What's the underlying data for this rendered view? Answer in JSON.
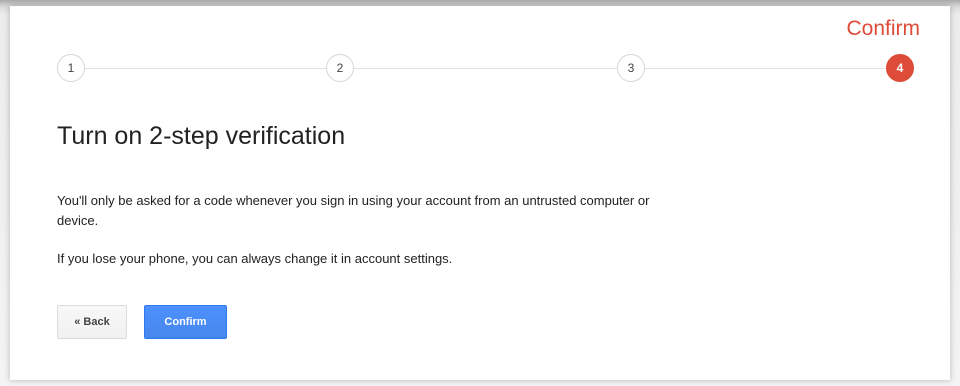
{
  "header": {
    "step_label": "Confirm"
  },
  "stepper": {
    "steps": [
      "1",
      "2",
      "3",
      "4"
    ],
    "active_step": 4,
    "colors": {
      "active": "#dd4b39",
      "inactive_border": "#d6d6d6"
    }
  },
  "main": {
    "title": "Turn on 2-step verification",
    "paragraph_1": "You'll only be asked for a code whenever you sign in using your account from an untrusted computer or device.",
    "paragraph_2": "If you lose your phone, you can always change it in account settings."
  },
  "buttons": {
    "back_label": "« Back",
    "confirm_label": "Confirm",
    "confirm_color": "#4d90fe"
  }
}
